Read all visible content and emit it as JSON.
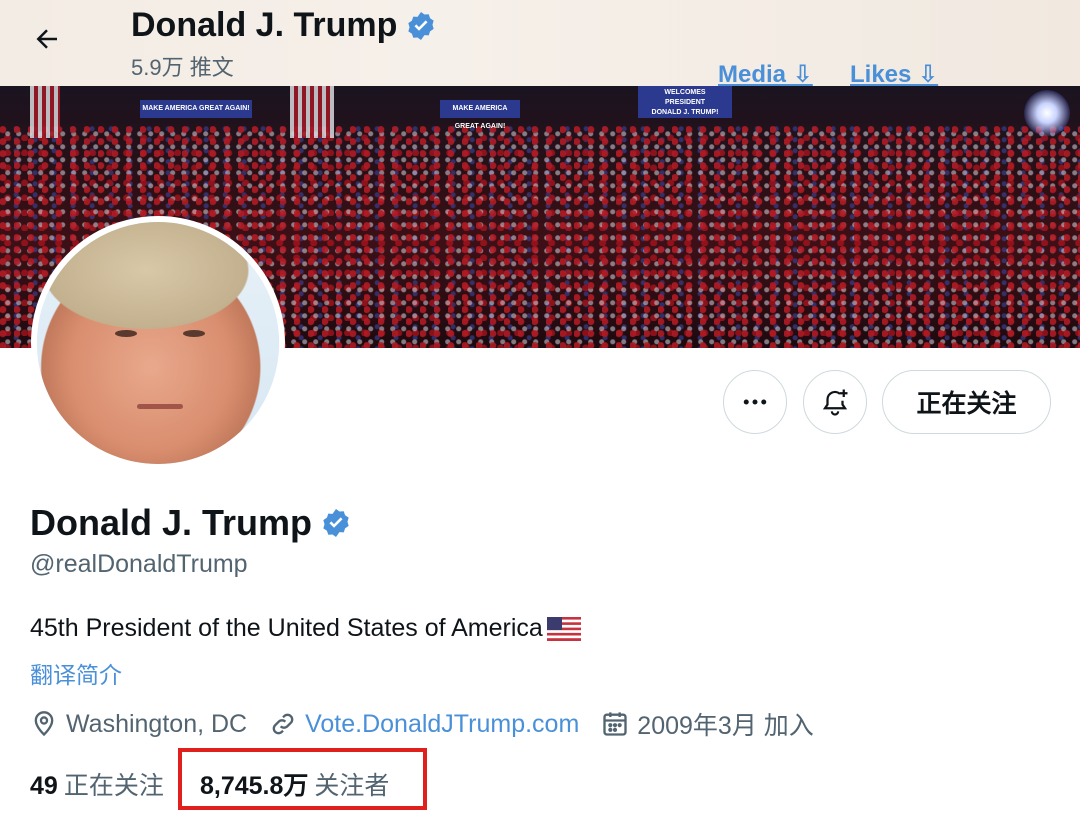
{
  "header": {
    "name": "Donald J. Trump",
    "tweet_count": "5.9万 推文",
    "media_link": "Media ⇩",
    "likes_link": "Likes ⇩"
  },
  "banner": {
    "sign_left": "MAKE AMERICA GREAT AGAIN!",
    "sign_mid": "MAKE AMERICA GREAT AGAIN!",
    "sign_stage_1": "WELCOMES",
    "sign_stage_2": "PRESIDENT",
    "sign_stage_3": "DONALD J. TRUMP!"
  },
  "actions": {
    "more": "more-icon",
    "notify": "bell-plus-icon",
    "follow_label": "正在关注"
  },
  "profile": {
    "name": "Donald J. Trump",
    "handle": "@realDonaldTrump",
    "bio": "45th President of the United States of America",
    "bio_emoji": "🇺🇸",
    "translate_link": "翻译简介",
    "location": "Washington, DC",
    "website": "Vote.DonaldJTrump.com",
    "joined": "2009年3月 加入"
  },
  "stats": {
    "following_count": "49",
    "following_label": "正在关注",
    "followers_count": "8,745.8万",
    "followers_label": "关注者"
  },
  "colors": {
    "verified": "#4a90d9",
    "link": "#4a90d9",
    "highlight": "#e0201c",
    "secondary_text": "#536471"
  }
}
